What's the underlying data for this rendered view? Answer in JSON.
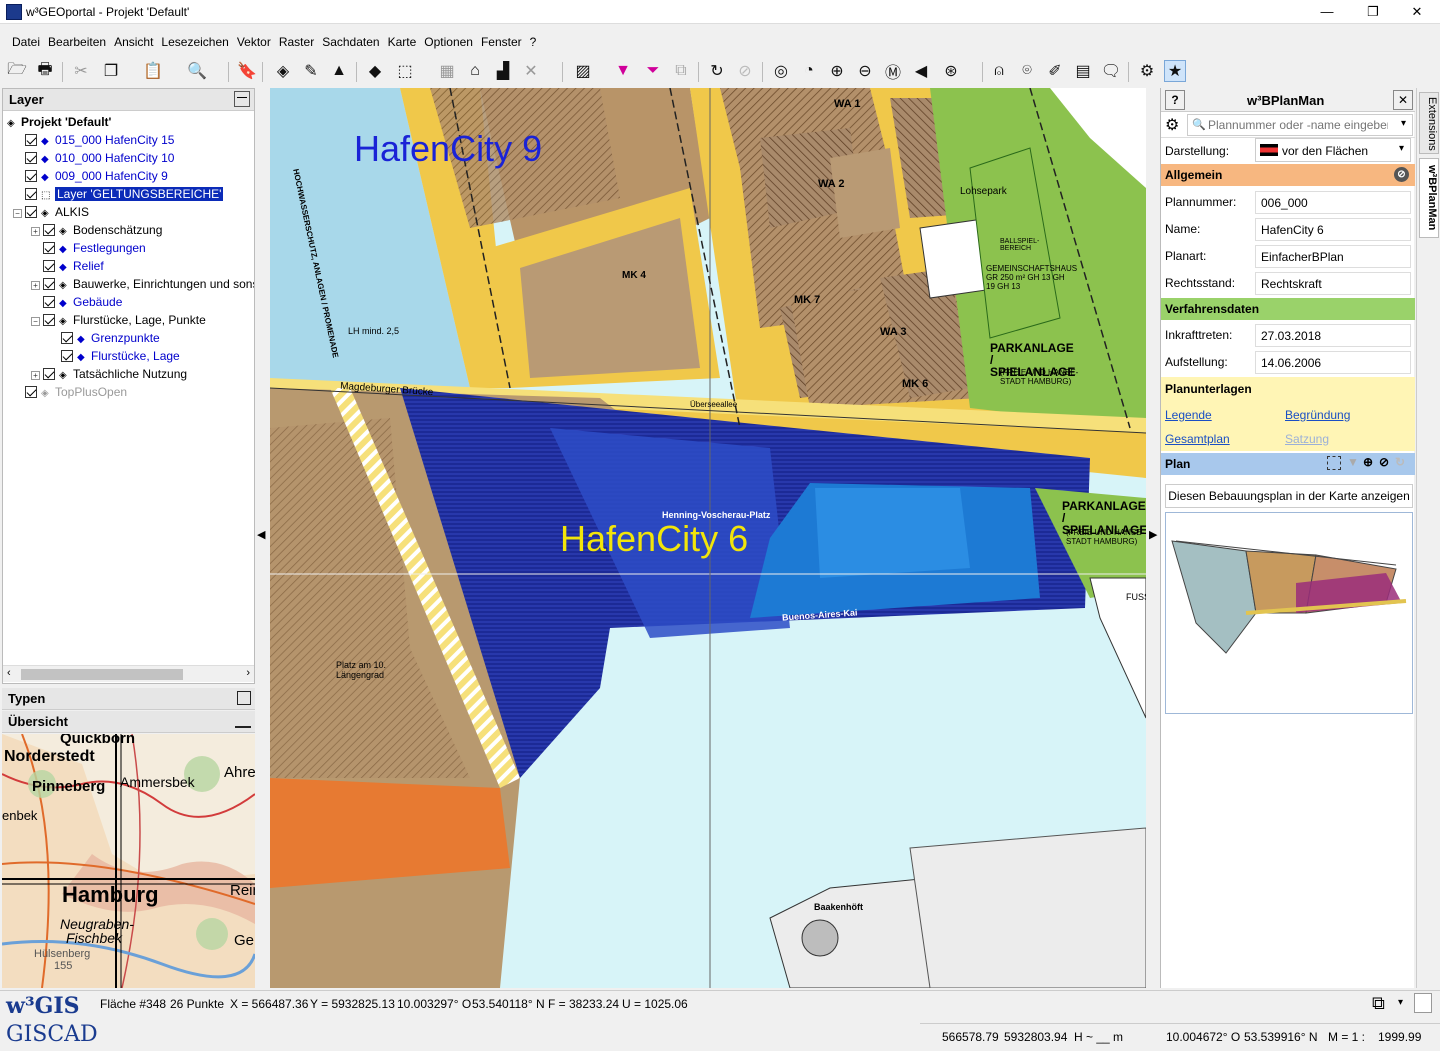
{
  "window": {
    "title": "w³GEOportal - Projekt 'Default'",
    "minimize": "—",
    "maximize": "❐",
    "close": "✕"
  },
  "menu": [
    "Datei",
    "Bearbeiten",
    "Ansicht",
    "Lesezeichen",
    "Vektor",
    "Raster",
    "Sachdaten",
    "Karte",
    "Optionen",
    "Fenster",
    "?"
  ],
  "toolbar": [
    "folder-icon",
    "print-icon",
    "cut-icon",
    "copy-icon",
    "paste-icon",
    "zoom-icon",
    "bookmark-icon",
    "layers-icon",
    "draw-icon",
    "terrain-icon",
    "select-icon",
    "select-area-icon",
    "grid-icon",
    "house-icon",
    "buildings-icon",
    "remove-icon",
    "hatch-icon",
    "filter-icon",
    "filter2-icon",
    "stack-icon",
    "refresh-icon",
    "stop-icon",
    "zoom-frame-icon",
    "zoom-prev-icon",
    "zoom-in-icon",
    "zoom-out-icon",
    "zoom-m-icon",
    "pan-left-icon",
    "zoom-full-icon",
    "person-icon",
    "target-icon",
    "edit-icon",
    "table-icon",
    "comment-icon",
    "settings-icon",
    "star-icon"
  ],
  "layers": {
    "title": "Layer",
    "collapse": "—",
    "items": [
      {
        "label": "Projekt 'Default'",
        "level": 0,
        "bold": true
      },
      {
        "label": "015_000 HafenCity 15",
        "level": 1,
        "blue": true
      },
      {
        "label": "010_000 HafenCity 10",
        "level": 1,
        "blue": true
      },
      {
        "label": "009_000 HafenCity 9",
        "level": 1,
        "blue": true
      },
      {
        "label": "Layer 'GELTUNGSBEREICHE'",
        "level": 1,
        "selected": true
      },
      {
        "label": "ALKIS",
        "level": 1
      },
      {
        "label": "Bodenschätzung",
        "level": 2
      },
      {
        "label": "Festlegungen",
        "level": 2,
        "blue": true
      },
      {
        "label": "Relief",
        "level": 2,
        "blue": true
      },
      {
        "label": "Bauwerke, Einrichtungen und sonstige",
        "level": 2
      },
      {
        "label": "Gebäude",
        "level": 2,
        "blue": true
      },
      {
        "label": "Flurstücke, Lage, Punkte",
        "level": 2
      },
      {
        "label": "Grenzpunkte",
        "level": 3,
        "blue": true
      },
      {
        "label": "Flurstücke, Lage",
        "level": 3,
        "blue": true
      },
      {
        "label": "Tatsächliche Nutzung",
        "level": 2
      },
      {
        "label": "TopPlusOpen",
        "level": 1,
        "grey": true
      }
    ]
  },
  "types": {
    "title": "Typen"
  },
  "overview": {
    "title": "Übersicht",
    "places": [
      "Quickborn",
      "Norderstedt",
      "Pinneberg",
      "Ammersbek",
      "Ahre",
      "enbek",
      "Hamburg",
      "Rein",
      "Neugraben-",
      "Fischbek",
      "Ge",
      "Hülsenberg",
      "155"
    ]
  },
  "map": {
    "labels": {
      "hc9": "HafenCity 9",
      "hc6": "HafenCity 6",
      "promenade": "HOCHWASSERSCHUTZ, ANLAGEN / PROMENADE",
      "lohsepark": "Lohsepark",
      "parkanlage1": "PARKANLAGE / SPIELANLAGE",
      "parkanlage1b": "(FREIE UND HANSE- STADT HAMBURG)",
      "parkanlage2": "PARKANLAGE / SPIELANLAGE",
      "parkanlage2b": "(FREIE UND HANSE- STADT HAMBURG)",
      "magdeburger": "Magdeburger Brücke",
      "henning": "Henning-Voscherau-Platz",
      "buenos": "Buenos-Aires-Kai",
      "bakenhoeft": "Baakenhöft",
      "platz": "Platz am 10. Längengrad",
      "mk4": "MK 4",
      "wa1": "WA 1",
      "wa2": "WA 2",
      "wa3": "WA 3",
      "mk6": "MK 6",
      "mk7": "MK 7",
      "gemeinschaftshaus": "GEMEINSCHAFTSHAUS GR 250 m² GH 13 GH 19 GH 13",
      "ballspiel": "BALLSPIEL- BEREICH",
      "ueberseeallee": "Überseeallee",
      "fuss": "FUSS",
      "lh": "LH mind. 2,5"
    }
  },
  "right_panel": {
    "help": "?",
    "title": "w³BPlanMan",
    "close": "✕",
    "search_placeholder": "Plannummer oder -name eingeben",
    "darstellung_label": "Darstellung:",
    "darstellung_value": "vor den Flächen",
    "allgemein": "Allgemein",
    "fields": [
      {
        "label": "Plannummer:",
        "value": "006_000"
      },
      {
        "label": "Name:",
        "value": "HafenCity 6"
      },
      {
        "label": "Planart:",
        "value": "EinfacherBPlan"
      },
      {
        "label": "Rechtsstand:",
        "value": "Rechtskraft"
      }
    ],
    "verfahrensdaten": "Verfahrensdaten",
    "dates": [
      {
        "label": "Inkrafttreten:",
        "value": "27.03.2018"
      },
      {
        "label": "Aufstellung:",
        "value": "14.06.2006"
      }
    ],
    "planunterlagen": "Planunterlagen",
    "links": {
      "legende": "Legende",
      "begruendung": "Begründung",
      "gesamtplan": "Gesamtplan",
      "satzung": "Satzung"
    },
    "plan": "Plan",
    "plan_button": "Diesen Bebauungsplan in der Karte anzeigen"
  },
  "side_tabs": [
    "Extensions",
    "w³BPlanMan"
  ],
  "status": {
    "logo1": "w³GIS",
    "logo2": "GISCAD",
    "row1": [
      "Fläche #348",
      "26 Punkte",
      "X = 566487.36",
      "Y = 5932825.13",
      "10.003297° O",
      "53.540118° N",
      "F = 38233.24",
      "U = 1025.06"
    ],
    "row2": [
      "566578.79",
      "5932803.94",
      "H ~ __ m",
      "10.004672° O",
      "53.539916° N",
      "M = 1 :",
      "1999.99"
    ]
  },
  "colors": {
    "accent": "#1a3b8f",
    "selection": "#0b2bb8",
    "allgemein": "#f7b780",
    "verfahren": "#9ad26a",
    "planunterlagen": "#fff5b5",
    "plan": "#a8c8ec"
  }
}
